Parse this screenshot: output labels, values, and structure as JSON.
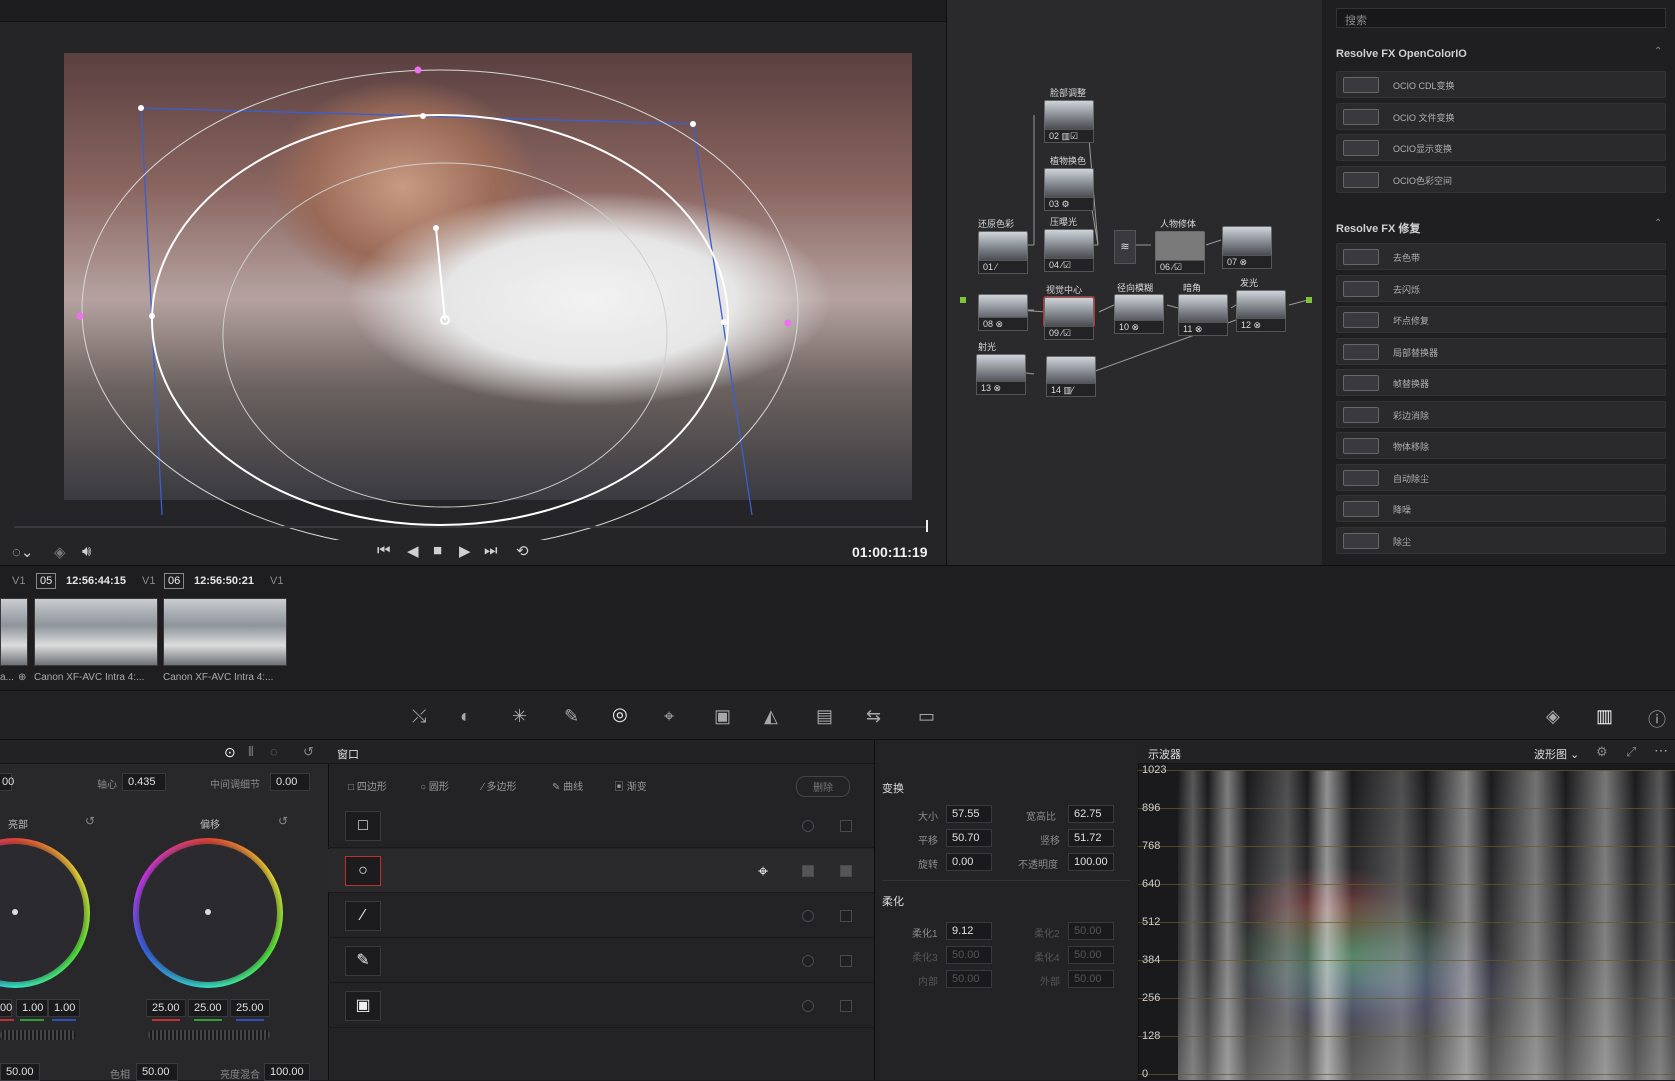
{
  "viewer": {
    "timecode": "01:00:11:19"
  },
  "timeline": {
    "track1": "V1",
    "clip1_num": "05",
    "clip1_tc": "12:56:44:15",
    "track2": "V1",
    "clip2_num": "06",
    "clip2_tc": "12:56:50:21",
    "track3": "V1",
    "clip1_name": "Canon XF-AVC Intra 4:...",
    "clip2_name": "Canon XF-AVC Intra 4:...",
    "clip0_name": "a..."
  },
  "nodes": {
    "n02_name": "脸部调整",
    "n02_label": "02",
    "n03_name": "植物换色",
    "n03_label": "03",
    "n01_name": "还原色彩",
    "n01_label": "01",
    "n04_name": "压曝光",
    "n04_label": "04",
    "n06_name": "人物修体",
    "n06_label": "06",
    "n07_label": "07",
    "n08_label": "08",
    "n09_name": "视觉中心",
    "n09_label": "09",
    "n10_name": "径向模糊",
    "n10_label": "10",
    "n11_name": "暗角",
    "n11_label": "11",
    "n12_name": "发光",
    "n12_label": "12",
    "n13_name": "射光",
    "n13_label": "13",
    "n14_label": "14"
  },
  "fx": {
    "search_placeholder": "搜索",
    "section1": "Resolve FX OpenColorIO",
    "section1_items": [
      "OCIO CDL变换",
      "OCIO 文件变换",
      "OCIO显示变换",
      "OCIO色彩空间"
    ],
    "section2": "Resolve FX 修复",
    "section2_items": [
      "去色带",
      "去闪烁",
      "坏点修复",
      "局部替换器",
      "帧替换器",
      "彩边消除",
      "物体移除",
      "自动除尘",
      "降噪",
      "除尘"
    ]
  },
  "wheels_panel": {
    "val_left_top": "00",
    "pivot_label": "轴心",
    "pivot_value": "0.435",
    "midtone_label": "中间调细节",
    "midtone_value": "0.00",
    "gain_label": "亮部",
    "offset_label": "偏移",
    "gain_vals": [
      "00",
      "1.00",
      "1.00"
    ],
    "offset_vals": [
      "25.00",
      "25.00",
      "25.00"
    ],
    "bottom_val1": "50.00",
    "hue_label": "色相",
    "hue_value": "50.00",
    "lummix_label": "亮度混合",
    "lummix_value": "100.00"
  },
  "window_panel": {
    "title": "窗口",
    "tool_quad": "四边形",
    "tool_circle": "圆形",
    "tool_poly": "多边形",
    "tool_curve": "曲线",
    "tool_gradient": "渐变",
    "delete": "删除"
  },
  "transform_panel": {
    "title": "变换",
    "size_label": "大小",
    "size_value": "57.55",
    "aspect_label": "宽高比",
    "aspect_value": "62.75",
    "pan_label": "平移",
    "pan_value": "50.70",
    "tilt_label": "竖移",
    "tilt_value": "51.72",
    "rotate_label": "旋转",
    "rotate_value": "0.00",
    "opacity_label": "不透明度",
    "opacity_value": "100.00",
    "soft_title": "柔化",
    "soft1_label": "柔化1",
    "soft1_value": "9.12",
    "soft2_label": "柔化2",
    "soft2_value": "50.00",
    "soft3_label": "柔化3",
    "soft3_value": "50.00",
    "soft4_label": "柔化4",
    "soft4_value": "50.00",
    "inside_label": "内部",
    "inside_value": "50.00",
    "outside_label": "外部",
    "outside_value": "50.00"
  },
  "scope": {
    "title": "示波器",
    "mode": "波形图",
    "y_labels": [
      "1023",
      "896",
      "768",
      "640",
      "512",
      "384",
      "256",
      "128",
      "0"
    ]
  }
}
